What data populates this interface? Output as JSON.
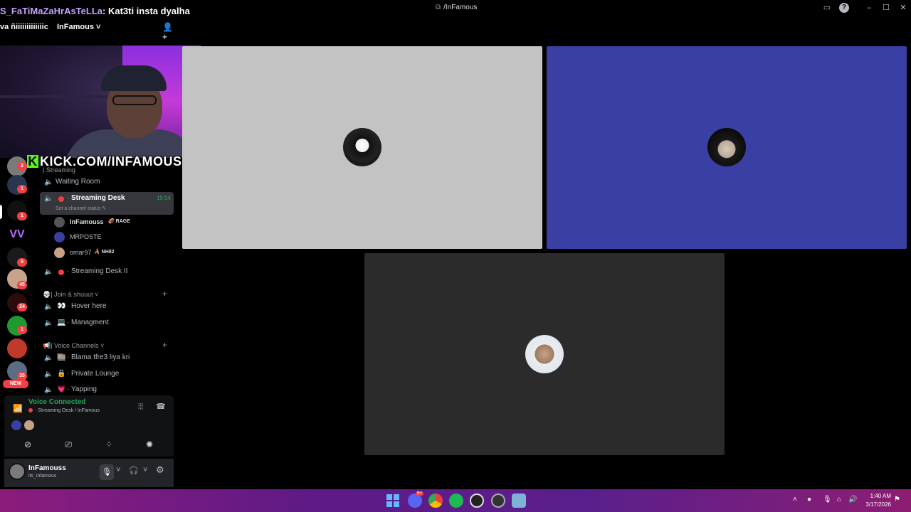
{
  "window": {
    "title": "/InFamous"
  },
  "chat_overlay": {
    "user": "S_FaTiMaZaHrAsTeLLa",
    "message": ": Kat3ti insta dyalha"
  },
  "server": {
    "prefix": "va ñiiiiiiiiiiiiic",
    "name": "InFamous ˅"
  },
  "stream_overlay": {
    "kick_text": "KICK.COM/INFAMOUSS",
    "kick_letter": "K"
  },
  "server_rail": {
    "badges": [
      "2",
      "1",
      "1",
      "9",
      "45",
      "24",
      "1",
      "35"
    ],
    "new_label": "NEW"
  },
  "channels": {
    "category_streaming": "| Streaming",
    "waiting_room": "Waiting Room",
    "streaming_desk": {
      "name": "Streaming Desk",
      "time": "19:54",
      "status": "Set a channel status ✎"
    },
    "voice_users": [
      {
        "name": "InFamouss",
        "tag": "RAGE",
        "tag_prefix": "🏈"
      },
      {
        "name": "MRPOSTE",
        "tag": "",
        "tag_prefix": ""
      },
      {
        "name": "omar97",
        "tag": "NH82",
        "tag_prefix": "🦂"
      }
    ],
    "streaming_desk_2": "Streaming Desk II",
    "category_join": "💀| Join & shuuut ˅",
    "hover_here": "Hover here",
    "managment": "Managment",
    "category_voice": "📢| Voice Channels ˅",
    "blama": "Blama tfre3 liya kri",
    "private_lounge": "Private Lounge",
    "yapping": "Yapping"
  },
  "voice_panel": {
    "title": "Voice Connected",
    "subtitle": "Streaming Desk / InFamous"
  },
  "user_panel": {
    "name": "InFamouss",
    "handle": "its_infamous"
  },
  "taskbar": {
    "time": "1:40 AM",
    "date": "3/17/2026",
    "discord_badge": "9+"
  },
  "colors": {
    "accent_green": "#23a559",
    "danger_red": "#f23f43",
    "tile_gray": "#c3c3c3",
    "tile_blue": "#3a3fa4",
    "tile_dark": "#2b2b2b"
  }
}
